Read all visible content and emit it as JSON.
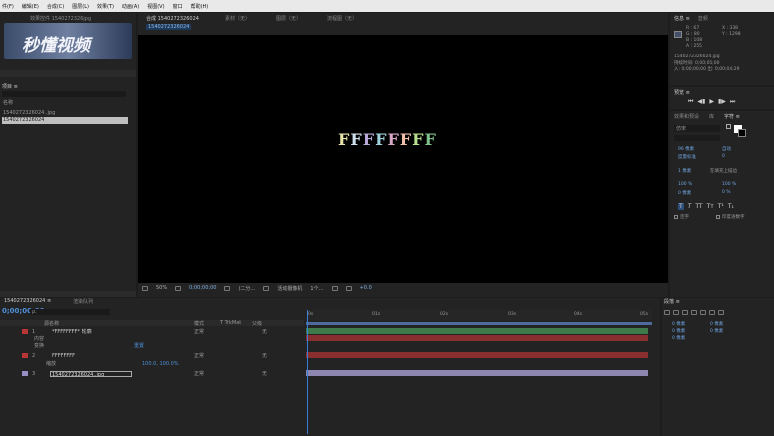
{
  "menu": [
    "件(F)",
    "编辑(E)",
    "合成(C)",
    "图层(L)",
    "效果(T)",
    "动画(A)",
    "视图(V)",
    "窗口",
    "帮助(H)"
  ],
  "project_panel": {
    "tab": "项目 ≡",
    "header_file": "效果控件 1540272326jpg",
    "watermark": "秒懂视频",
    "search_label": "名称",
    "items": [
      "1540272326024..jpg",
      "1540272326024"
    ]
  },
  "comp_panel": {
    "tabs": [
      "合成 1540272326024",
      "素材（无）",
      "图层（无）",
      "流程图（无）"
    ],
    "sub_tab": "1540272326024",
    "text_content": "FFFFFFFF",
    "text_colors": [
      "#e8e3a8",
      "#cfe1ef",
      "#b9a7d9",
      "#9ed1dc",
      "#d7a7c8",
      "#f0bfa8",
      "#b7df8e",
      "#7fc08b"
    ],
    "footer": {
      "zoom": "50%",
      "timecode": "0;00;00;00",
      "quality": "(二分…",
      "camera": "活动摄像机",
      "views": "1个…",
      "exposure": "+0.0"
    }
  },
  "info_panel": {
    "tabs": [
      "信息 ≡",
      "音频"
    ],
    "r": "R : 67",
    "g": "G : 80",
    "b": "B : 108",
    "a": "A : 255",
    "x": "X : 338",
    "y": "Y : 1298",
    "file_name": "1540272326024.jpg",
    "duration": "持续时间: 0;00;05;00",
    "range": "入: 0;00;00;00  出: 0;00;04;29"
  },
  "preview_panel": {
    "title": "预览 ≡"
  },
  "character_panel": {
    "tabs": [
      "效果和预设",
      "库",
      "字符 ≡"
    ],
    "font": "仿宋",
    "size": "96 像素",
    "leading": "自动",
    "tracking": "度量标准",
    "kerning": "0",
    "stroke": "1 像素",
    "stroke_type": "在填充上描边",
    "vscale": "100 %",
    "hscale": "100 %",
    "baseline": "0 像素",
    "tsume": "0 %",
    "style_buttons": [
      "T",
      "T",
      "TT",
      "Tт",
      "T¹",
      "T₁"
    ],
    "options": [
      "连字",
      "印度语数字"
    ]
  },
  "paragraph_panel": {
    "title": "段落 ≡",
    "values": [
      "0 像素",
      "0 像素",
      "0 像素",
      "0 像素",
      "0 像素"
    ]
  },
  "timeline": {
    "tabs": [
      "1540272326024 ≡",
      "渲染队列"
    ],
    "timecode": "0;00;00;00",
    "search_placeholder": "ρ.",
    "columns": {
      "source": "源名称",
      "mode": "模式",
      "trkmat": "T  TrkMat",
      "parent": "父级"
    },
    "ruler_marks": [
      "0s",
      "01s",
      "02s",
      "03s",
      "04s",
      "05s"
    ],
    "layers": [
      {
        "num": "1",
        "name": "*FFFFFFFF* 轮廓",
        "mode": "正常",
        "parent": "无",
        "color": "#b73535"
      },
      {
        "num": "",
        "name": "内容",
        "mode": "",
        "parent": "",
        "color": ""
      },
      {
        "num": "",
        "name": "变换",
        "mode": "",
        "parent": "",
        "color": ""
      },
      {
        "num": "2",
        "name": "FFFFFFFF",
        "mode": "正常",
        "parent": "无",
        "color": "#b73535"
      },
      {
        "num": "",
        "name": "缩放",
        "mode": "",
        "parent": "",
        "color": ""
      },
      {
        "num": "3",
        "name": "1540272326024..jpg",
        "mode": "正常",
        "parent": "无",
        "color": "#9a8ec7"
      }
    ],
    "text_label": "重置",
    "scale_value": "100.0, 100.0%"
  }
}
